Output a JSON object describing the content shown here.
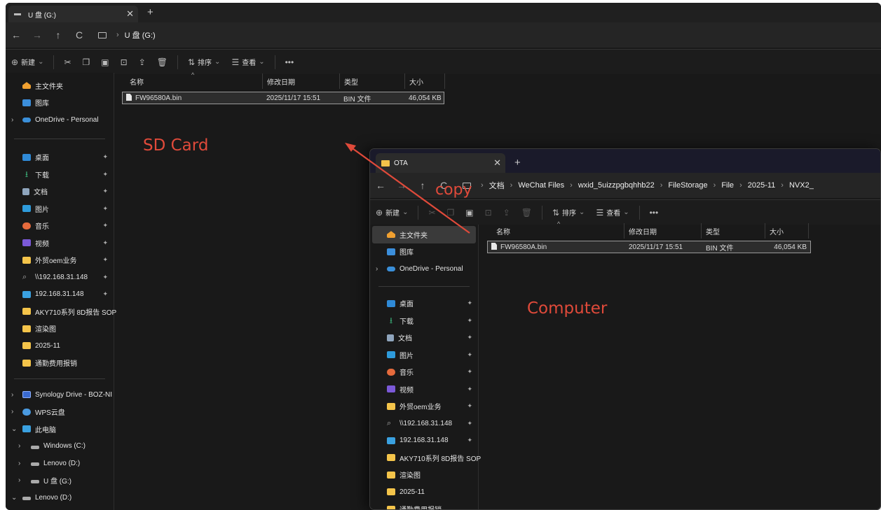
{
  "sd_window": {
    "tab_title": "U 盘 (G:)",
    "tab_close": "✕",
    "tab_new": "+",
    "nav": {
      "back": "←",
      "forward": "→",
      "up": "↑",
      "refresh": "C"
    },
    "address": [
      "U 盘 (G:)"
    ],
    "toolbar": {
      "new_label": "新建",
      "sort_label": "排序",
      "view_label": "查看",
      "more": "•••"
    },
    "sidebar": {
      "top": [
        "主文件夹",
        "图库",
        "OneDrive - Personal"
      ],
      "quick": [
        "桌面",
        "下载",
        "文档",
        "图片",
        "音乐",
        "视频",
        "外贸oem业务",
        "\\\\192.168.31.148",
        "192.168.31.148",
        "AKY710系列 8D报告 SOP",
        "渲染图",
        "2025-11",
        "通勤费用报销"
      ],
      "bottom": [
        "Synology Drive - BOZ-NI",
        "WPS云盘",
        "此电脑",
        "Windows (C:)",
        "Lenovo (D:)",
        "U 盘 (G:)",
        "Lenovo (D:)"
      ]
    },
    "columns": {
      "name": "名称",
      "modified": "修改日期",
      "type": "类型",
      "size": "大小"
    },
    "files": [
      {
        "name": "FW96580A.bin",
        "modified": "2025/11/17 15:51",
        "type": "BIN 文件",
        "size": "46,054 KB"
      }
    ]
  },
  "pc_window": {
    "tab_title": "OTA",
    "tab_close": "✕",
    "tab_new": "+",
    "nav": {
      "back": "←",
      "forward": "→",
      "up": "↑",
      "refresh": "C"
    },
    "address": [
      "文档",
      "WeChat Files",
      "wxid_5uizzpgbqhhb22",
      "FileStorage",
      "File",
      "2025-11",
      "NVX2_"
    ],
    "toolbar": {
      "new_label": "新建",
      "sort_label": "排序",
      "view_label": "查看",
      "more": "•••"
    },
    "sidebar": {
      "top": [
        "主文件夹",
        "图库",
        "OneDrive - Personal"
      ],
      "quick": [
        "桌面",
        "下载",
        "文档",
        "图片",
        "音乐",
        "视频",
        "外贸oem业务",
        "\\\\192.168.31.148",
        "192.168.31.148",
        "AKY710系列 8D报告 SOP",
        "渲染图",
        "2025-11",
        "通勤费用报销"
      ]
    },
    "columns": {
      "name": "名称",
      "modified": "修改日期",
      "type": "类型",
      "size": "大小"
    },
    "files": [
      {
        "name": "FW96580A.bin",
        "modified": "2025/11/17 15:51",
        "type": "BIN 文件",
        "size": "46,054 KB"
      }
    ]
  },
  "annotations": {
    "sd_card": "SD Card",
    "copy": "copy",
    "computer": "Computer"
  },
  "colors": {
    "annotation": "#e04a3a",
    "background": "#191919",
    "accent_folder": "#f4c44a"
  }
}
